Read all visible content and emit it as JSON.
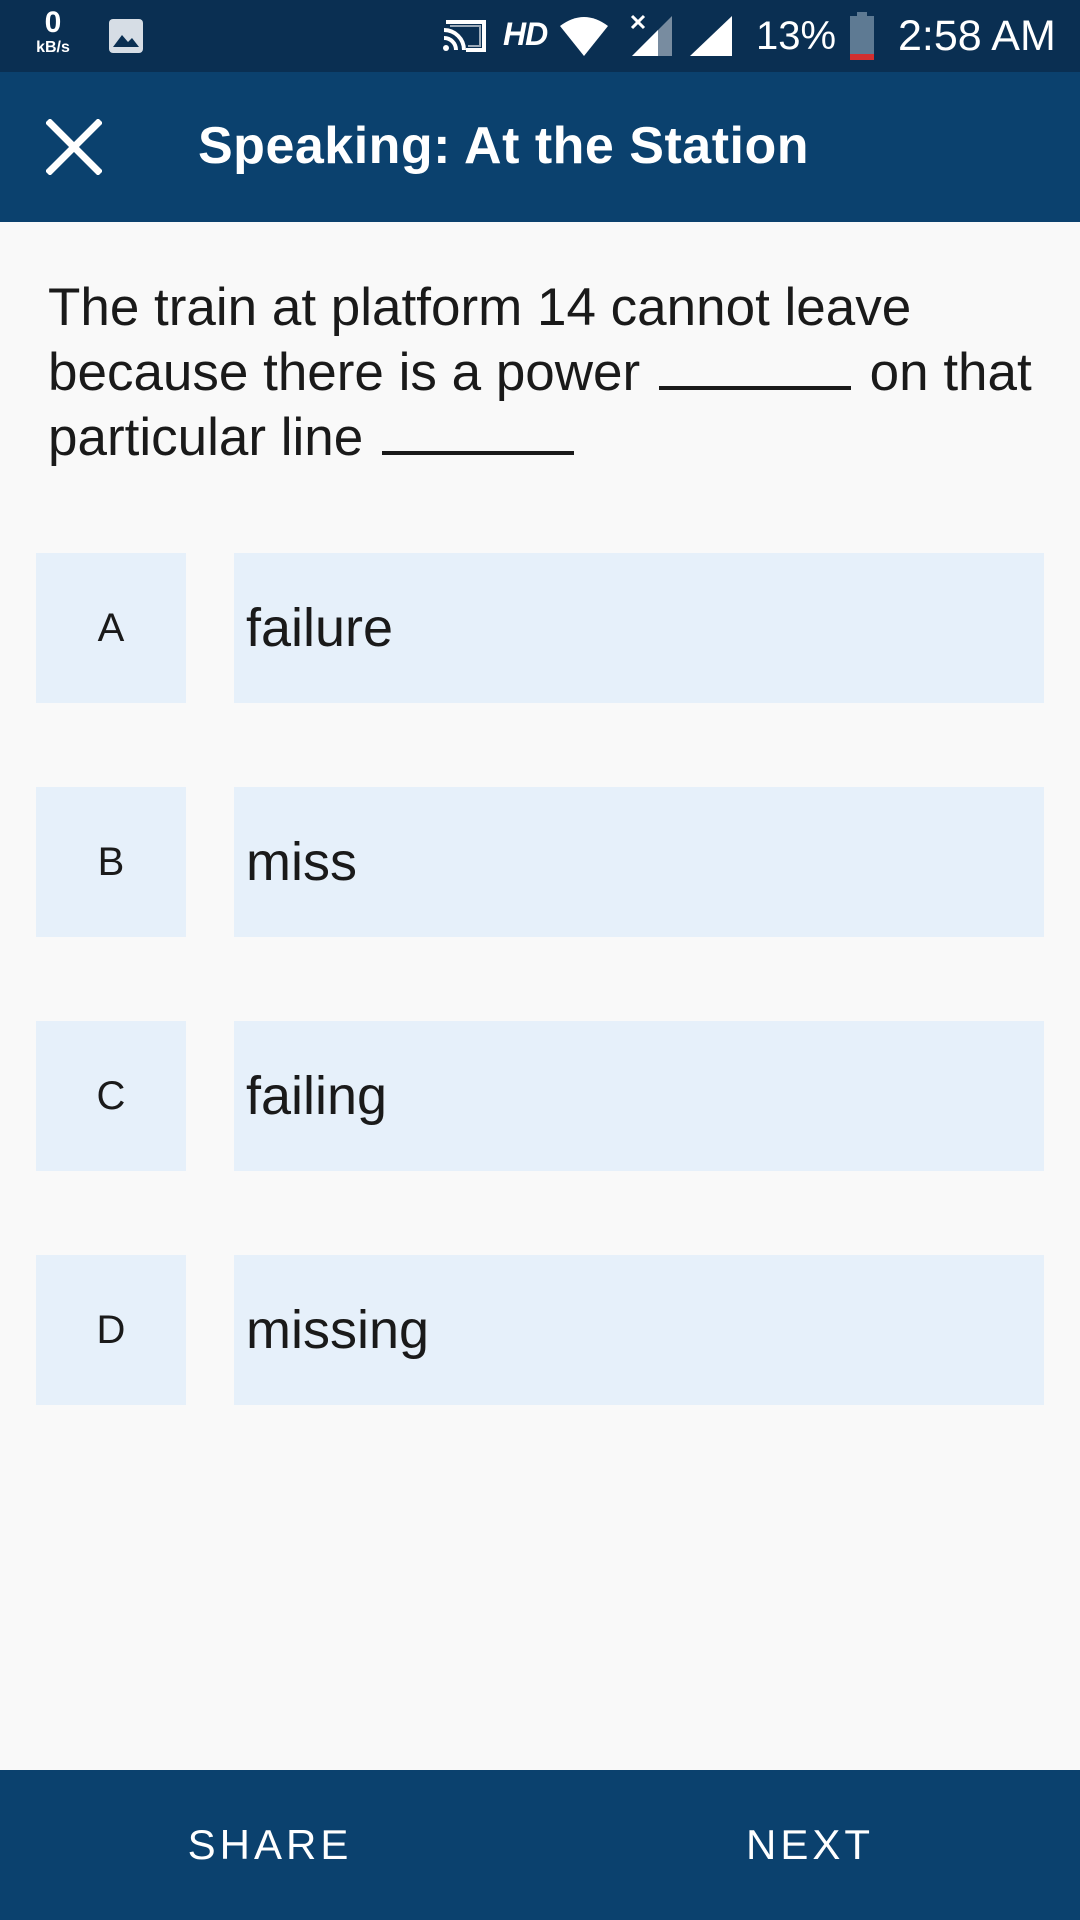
{
  "status_bar": {
    "net_speed_value": "0",
    "net_speed_unit": "kB/s",
    "network_type": "HD",
    "battery_percent": "13%",
    "time": "2:58 AM",
    "icons": [
      "gallery-icon",
      "cast-icon",
      "wifi-icon",
      "signal-x-icon",
      "signal-icon",
      "battery-icon"
    ]
  },
  "header": {
    "title": "Speaking: At the Station",
    "close_icon": "close-icon"
  },
  "question": {
    "part1": "The train at platform 14 cannot leave because there is a power",
    "part2": "on that particular line"
  },
  "options": [
    {
      "letter": "A",
      "text": "failure"
    },
    {
      "letter": "B",
      "text": "miss"
    },
    {
      "letter": "C",
      "text": "failing"
    },
    {
      "letter": "D",
      "text": "missing"
    }
  ],
  "footer": {
    "share_label": "SHARE",
    "next_label": "NEXT"
  },
  "colors": {
    "status_bar_bg": "#0a2f52",
    "app_bar_bg": "#0b416e",
    "option_bg": "#e6f0fa",
    "page_bg": "#f9f9f9",
    "battery_low": "#d32f2f"
  }
}
